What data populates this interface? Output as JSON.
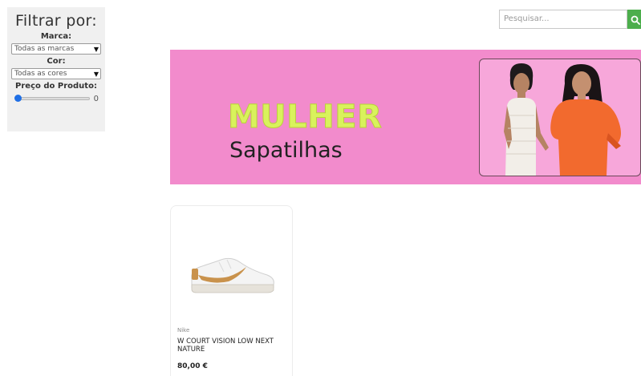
{
  "filters": {
    "title": "Filtrar por:",
    "brand_label": "Marca:",
    "brand_selected": "Todas as marcas",
    "color_label": "Cor:",
    "color_selected": "Todas as cores",
    "price_label": "Preço do Produto:",
    "price_value": "0",
    "price_slider_fraction": 0
  },
  "search": {
    "placeholder": "Pesquisar..."
  },
  "banner": {
    "title": "MULHER",
    "subtitle": "Sapatilhas",
    "colors": {
      "background": "#f28bcc",
      "title": "#d9f25c"
    }
  },
  "products": [
    {
      "brand": "Nike",
      "name": "W COURT VISION LOW NEXT NATURE",
      "price": "80,00 €"
    }
  ],
  "icons": {
    "search_button": "search-icon",
    "select_arrow": "chevron-down-icon"
  },
  "colors": {
    "search_button": "#4cae4c",
    "slider_thumb": "#1f6fe5",
    "filter_panel": "#f0f0f0"
  }
}
